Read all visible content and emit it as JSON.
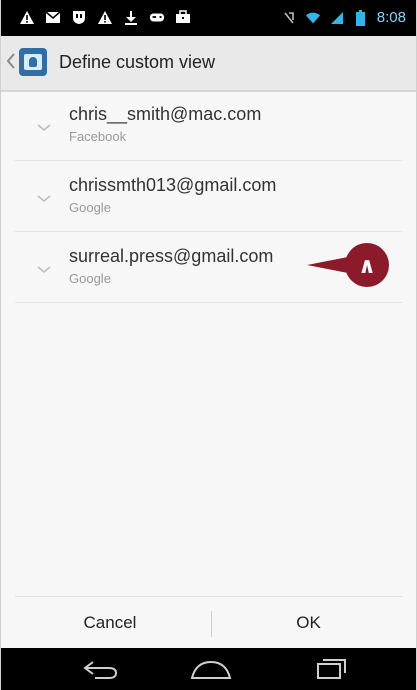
{
  "status_bar": {
    "left_icons": [
      "warning-icon",
      "mail-icon",
      "shield-icon",
      "warning-icon",
      "download-icon",
      "gamepad-icon",
      "briefcase-icon"
    ],
    "right_icons": [
      "no-sim-icon",
      "wifi-icon",
      "signal-icon",
      "battery-icon"
    ],
    "time": "8:08",
    "time_color": "#7fd4ff"
  },
  "action_bar": {
    "title": "Define custom view"
  },
  "accounts": [
    {
      "email": "chris__smith@mac.com",
      "type": "Facebook"
    },
    {
      "email": "chrissmth013@gmail.com",
      "type": "Google"
    },
    {
      "email": "surreal.press@gmail.com",
      "type": "Google"
    }
  ],
  "callout": {
    "label": "∧",
    "color": "#8b1a2b"
  },
  "dialog": {
    "cancel_label": "Cancel",
    "ok_label": "OK"
  },
  "nav_bar": {
    "buttons": [
      "back-icon",
      "home-icon",
      "recents-icon"
    ]
  }
}
